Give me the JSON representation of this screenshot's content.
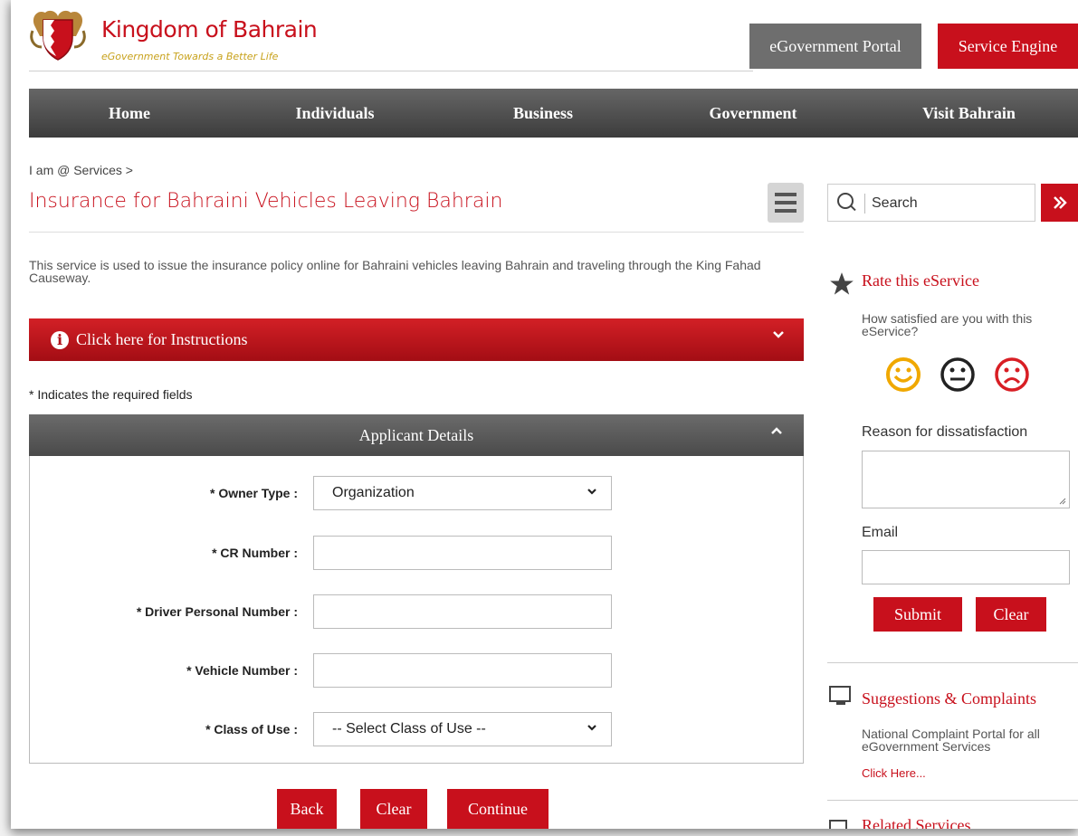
{
  "header": {
    "brand_title": "Kingdom of Bahrain",
    "brand_subtitle": "eGovernment Towards a Better Life",
    "portal_button": "eGovernment Portal",
    "engine_button": "Service Engine"
  },
  "nav": {
    "items": [
      {
        "label": "Home"
      },
      {
        "label": "Individuals"
      },
      {
        "label": "Business"
      },
      {
        "label": "Government"
      },
      {
        "label": "Visit Bahrain"
      }
    ]
  },
  "breadcrumb": "I am @ Services >",
  "page_title": "Insurance for Bahraini Vehicles Leaving Bahrain",
  "description": "This service is used to issue the insurance policy online for Bahraini vehicles leaving Bahrain and traveling through the King Fahad Causeway.",
  "instructions": {
    "label": "Click here for Instructions"
  },
  "required_note": "* Indicates the required fields",
  "applicant_panel": {
    "title": "Applicant Details",
    "fields": {
      "owner_type": {
        "label": "* Owner Type :",
        "value": "Organization"
      },
      "cr_number": {
        "label": "* CR Number :",
        "value": ""
      },
      "driver_personal_number": {
        "label": "* Driver Personal Number :",
        "value": ""
      },
      "vehicle_number": {
        "label": "* Vehicle Number :",
        "value": ""
      },
      "class_of_use": {
        "label": "* Class of Use :",
        "value": "-- Select Class of Use --"
      }
    }
  },
  "actions": {
    "back": "Back",
    "clear": "Clear",
    "continue": "Continue"
  },
  "sidebar": {
    "search_placeholder": "Search",
    "rate": {
      "title": "Rate this eService",
      "question": "How satisfied are you with this eService?",
      "reason_label": "Reason for dissatisfaction",
      "email_label": "Email",
      "submit": "Submit",
      "clear": "Clear"
    },
    "suggestions": {
      "title": "Suggestions & Complaints",
      "text": "National Complaint Portal for all eGovernment Services",
      "link": "Click Here..."
    },
    "related": {
      "title": "Related Services"
    }
  },
  "colors": {
    "accent": "#c8101c",
    "nav": "#4a4a4a",
    "happy": "#f0a800"
  }
}
